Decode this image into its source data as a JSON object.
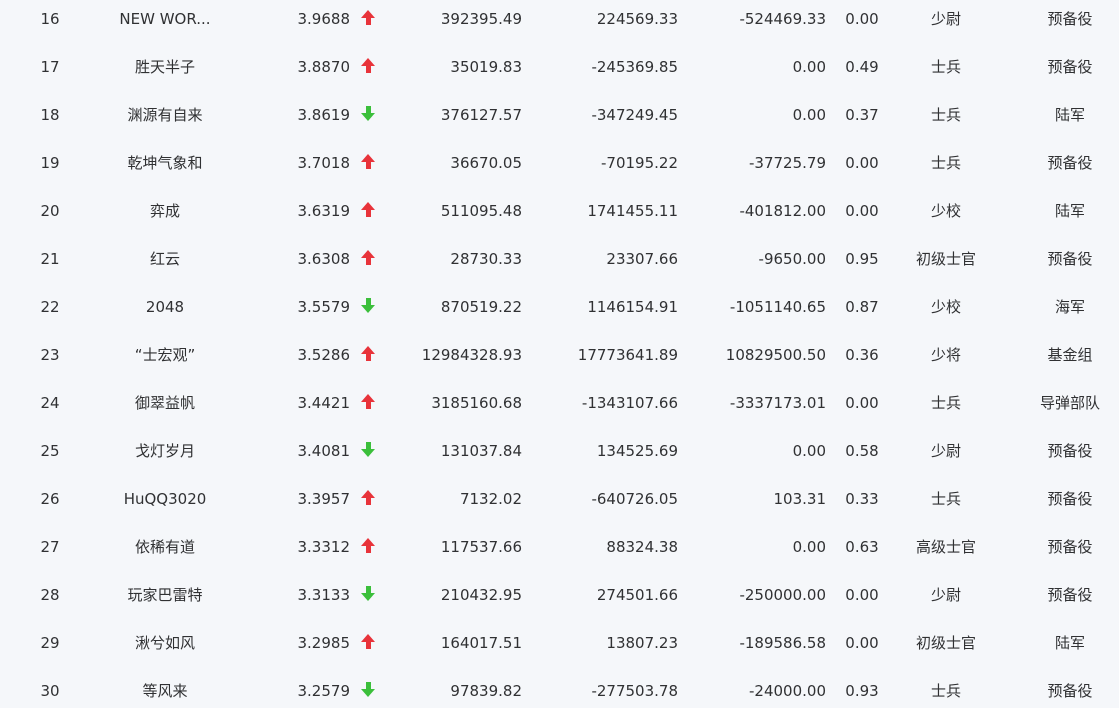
{
  "colors": {
    "background": "#f5f7fa",
    "text": "#303133",
    "up": "#e8333a",
    "down": "#3bbf3b"
  },
  "rows": [
    {
      "rank": "16",
      "name": "NEW WOR...",
      "score": "3.9688",
      "trend": "up",
      "v1": "392395.49",
      "v2": "224569.33",
      "v3": "-524469.33",
      "ratio": "0.00",
      "title": "少尉",
      "unit": "预备役"
    },
    {
      "rank": "17",
      "name": "胜天半子",
      "score": "3.8870",
      "trend": "up",
      "v1": "35019.83",
      "v2": "-245369.85",
      "v3": "0.00",
      "ratio": "0.49",
      "title": "士兵",
      "unit": "预备役"
    },
    {
      "rank": "18",
      "name": "渊源有自来",
      "score": "3.8619",
      "trend": "down",
      "v1": "376127.57",
      "v2": "-347249.45",
      "v3": "0.00",
      "ratio": "0.37",
      "title": "士兵",
      "unit": "陆军"
    },
    {
      "rank": "19",
      "name": "乾坤气象和",
      "score": "3.7018",
      "trend": "up",
      "v1": "36670.05",
      "v2": "-70195.22",
      "v3": "-37725.79",
      "ratio": "0.00",
      "title": "士兵",
      "unit": "预备役"
    },
    {
      "rank": "20",
      "name": "弈成",
      "score": "3.6319",
      "trend": "up",
      "v1": "511095.48",
      "v2": "1741455.11",
      "v3": "-401812.00",
      "ratio": "0.00",
      "title": "少校",
      "unit": "陆军"
    },
    {
      "rank": "21",
      "name": "红云",
      "score": "3.6308",
      "trend": "up",
      "v1": "28730.33",
      "v2": "23307.66",
      "v3": "-9650.00",
      "ratio": "0.95",
      "title": "初级士官",
      "unit": "预备役"
    },
    {
      "rank": "22",
      "name": "2048",
      "score": "3.5579",
      "trend": "down",
      "v1": "870519.22",
      "v2": "1146154.91",
      "v3": "-1051140.65",
      "ratio": "0.87",
      "title": "少校",
      "unit": "海军"
    },
    {
      "rank": "23",
      "name": "“士宏观”",
      "score": "3.5286",
      "trend": "up",
      "v1": "12984328.93",
      "v2": "17773641.89",
      "v3": "10829500.50",
      "ratio": "0.36",
      "title": "少将",
      "unit": "基金组"
    },
    {
      "rank": "24",
      "name": "御翠益帆",
      "score": "3.4421",
      "trend": "up",
      "v1": "3185160.68",
      "v2": "-1343107.66",
      "v3": "-3337173.01",
      "ratio": "0.00",
      "title": "士兵",
      "unit": "导弹部队"
    },
    {
      "rank": "25",
      "name": "戈灯岁月",
      "score": "3.4081",
      "trend": "down",
      "v1": "131037.84",
      "v2": "134525.69",
      "v3": "0.00",
      "ratio": "0.58",
      "title": "少尉",
      "unit": "预备役"
    },
    {
      "rank": "26",
      "name": "HuQQ3020",
      "score": "3.3957",
      "trend": "up",
      "v1": "7132.02",
      "v2": "-640726.05",
      "v3": "103.31",
      "ratio": "0.33",
      "title": "士兵",
      "unit": "预备役"
    },
    {
      "rank": "27",
      "name": "依稀有道",
      "score": "3.3312",
      "trend": "up",
      "v1": "117537.66",
      "v2": "88324.38",
      "v3": "0.00",
      "ratio": "0.63",
      "title": "高级士官",
      "unit": "预备役"
    },
    {
      "rank": "28",
      "name": "玩家巴雷特",
      "score": "3.3133",
      "trend": "down",
      "v1": "210432.95",
      "v2": "274501.66",
      "v3": "-250000.00",
      "ratio": "0.00",
      "title": "少尉",
      "unit": "预备役"
    },
    {
      "rank": "29",
      "name": "湫兮如风",
      "score": "3.2985",
      "trend": "up",
      "v1": "164017.51",
      "v2": "13807.23",
      "v3": "-189586.58",
      "ratio": "0.00",
      "title": "初级士官",
      "unit": "陆军"
    },
    {
      "rank": "30",
      "name": "等风来",
      "score": "3.2579",
      "trend": "down",
      "v1": "97839.82",
      "v2": "-277503.78",
      "v3": "-24000.00",
      "ratio": "0.93",
      "title": "士兵",
      "unit": "预备役"
    }
  ]
}
